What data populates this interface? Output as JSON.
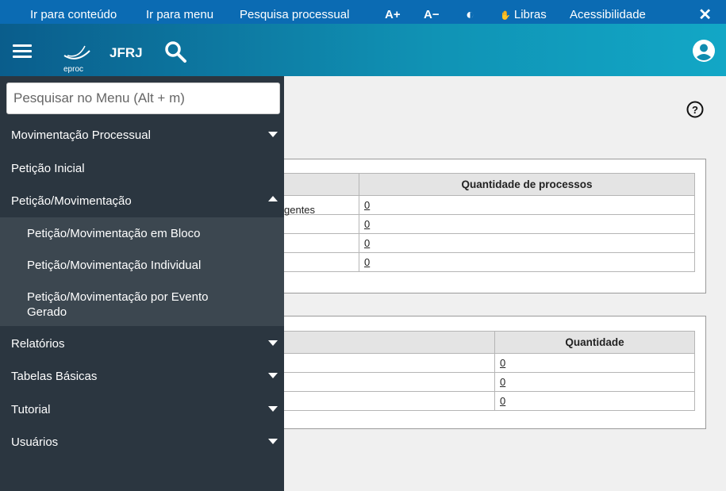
{
  "a11y_bar": {
    "skip_content": "Ir para conteúdo",
    "skip_menu": "Ir para menu",
    "process_search": "Pesquisa processual",
    "font_increase": "A+",
    "font_decrease": "A−",
    "contrast_icon": "◐",
    "libras": "Libras",
    "accessibility": "Acessibilidade",
    "close": "✕"
  },
  "header": {
    "logo_text": "eproc",
    "court": "JFRJ"
  },
  "sidebar": {
    "search_placeholder": "Pesquisar no Menu (Alt + m)",
    "items": [
      {
        "label": "Movimentação Processual"
      },
      {
        "label": "Petição Inicial"
      },
      {
        "label": "Petição/Movimentação"
      },
      {
        "label": "Relatórios"
      },
      {
        "label": "Tabelas Básicas"
      },
      {
        "label": "Tutorial"
      },
      {
        "label": "Usuários"
      }
    ],
    "subitems": [
      {
        "label": "Petição/Movimentação em Bloco"
      },
      {
        "label": "Petição/Movimentação Individual"
      },
      {
        "label": "Petição/Movimentação por Evento Gerado"
      }
    ]
  },
  "main": {
    "table1": {
      "header": "Quantidade de processos",
      "partial_label": "gentes",
      "values": [
        "0",
        "0",
        "0",
        "0"
      ]
    },
    "table2": {
      "header": "Quantidade",
      "values": [
        "0",
        "0",
        "0"
      ]
    }
  },
  "colors": {
    "accent": "#0b6bb3",
    "sidebar": "#2b3640",
    "submenu": "#3c4750"
  }
}
